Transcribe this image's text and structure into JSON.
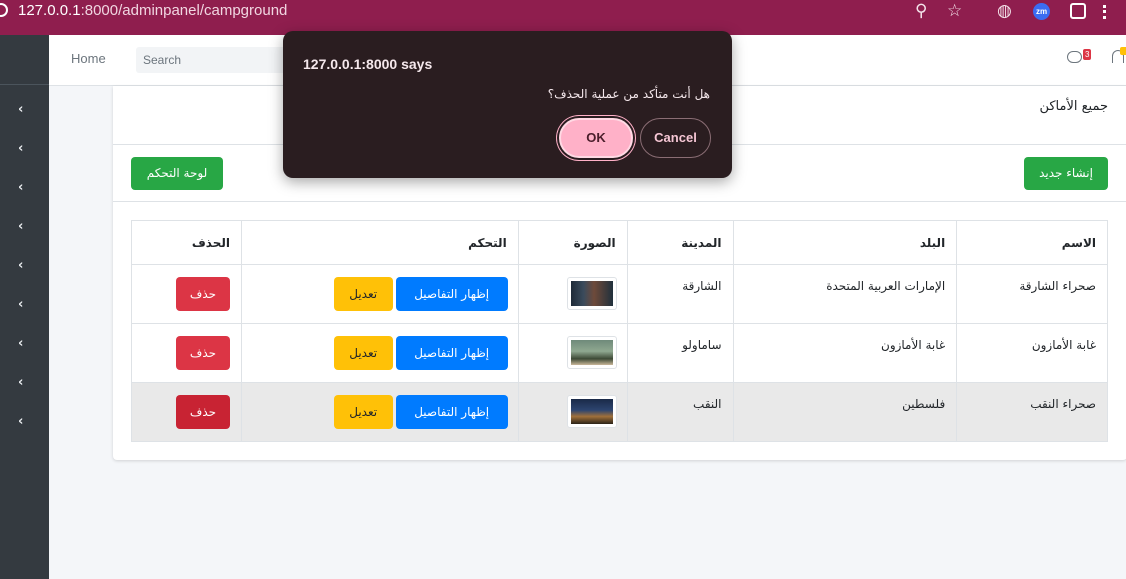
{
  "browser": {
    "url_host": "127.0.0.1",
    "url_rest": ":8000/adminpanel/campground",
    "icons": [
      "zoom-icon",
      "star-icon",
      "globe-icon",
      "zm-extension-icon",
      "extensions-icon",
      "menu-icon"
    ],
    "zm_label": "zm",
    "theme_color": "#8f1e4e"
  },
  "navbar": {
    "home": "Home",
    "search_placeholder": "Search",
    "messages_count": "3"
  },
  "sidebar": {
    "item_count": 9
  },
  "card": {
    "title": "جميع الأماكن",
    "create_button": "إنشاء جديد",
    "dashboard_button": "لوحة التحكم"
  },
  "table": {
    "headers": {
      "name": "الاسم",
      "country": "البلد",
      "city": "المدينة",
      "image": "الصورة",
      "control": "التحكم",
      "delete": "الحذف"
    },
    "rows": [
      {
        "name": "صحراء الشارقة",
        "country": "الإمارات العربية المتحدة",
        "city": "الشارقة",
        "show": "إظهار التفاصيل",
        "edit": "تعديل",
        "delete": "حذف"
      },
      {
        "name": "غابة الأمازون",
        "country": "غابة الأمازون",
        "city": "ساماولو",
        "show": "إظهار التفاصيل",
        "edit": "تعديل",
        "delete": "حذف"
      },
      {
        "name": "صحراء النقب",
        "country": "فلسطين",
        "city": "النقب",
        "show": "إظهار التفاصيل",
        "edit": "تعديل",
        "delete": "حذف"
      }
    ]
  },
  "dialog": {
    "title": "127.0.0.1:8000 says",
    "message": "هل أنت متأكد من عملية الحذف؟",
    "ok": "OK",
    "cancel": "Cancel"
  },
  "colors": {
    "success": "#28a745",
    "primary": "#007bff",
    "warning": "#ffc107",
    "danger": "#dc3545",
    "sidebar": "#343a40"
  }
}
